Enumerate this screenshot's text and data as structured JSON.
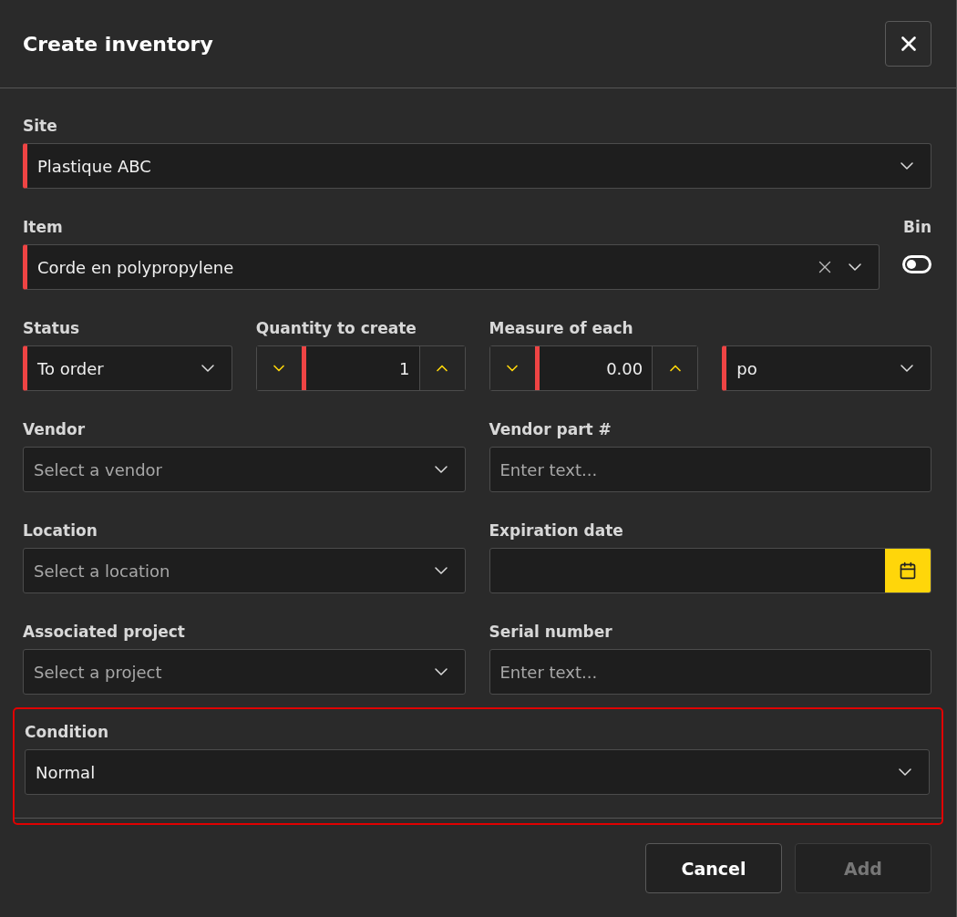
{
  "dialog": {
    "title": "Create inventory"
  },
  "rows": [
    {
      "kind": "full",
      "fields": [
        {
          "kind": "select",
          "label": "Site",
          "value": "Plastique ABC",
          "required": true
        }
      ]
    },
    {
      "kind": "item",
      "fields": [
        {
          "kind": "select",
          "label": "Item",
          "value": "Corde en polypropylene",
          "required": true,
          "clearable": true
        },
        {
          "kind": "toggle",
          "label": "Bin",
          "on": false
        }
      ]
    },
    {
      "kind": "quad",
      "fields": [
        {
          "kind": "select",
          "label": "Status",
          "value": "To order",
          "required": true
        },
        {
          "kind": "stepper",
          "label": "Quantity to create",
          "value": "1",
          "required": true
        },
        {
          "kind": "stepper",
          "label": "Measure of each",
          "value": "0.00",
          "required": true
        },
        {
          "kind": "select",
          "value": "po",
          "required": true
        }
      ]
    },
    {
      "kind": "pair",
      "fields": [
        {
          "kind": "select",
          "label": "Vendor",
          "placeholder": "Select a vendor",
          "required": false
        },
        {
          "kind": "text",
          "label": "Vendor part #",
          "placeholder": "Enter text...",
          "required": false
        }
      ]
    },
    {
      "kind": "pair",
      "fields": [
        {
          "kind": "select",
          "label": "Location",
          "placeholder": "Select a location",
          "required": false
        },
        {
          "kind": "date",
          "label": "Expiration date",
          "required": false
        }
      ]
    },
    {
      "kind": "pair",
      "fields": [
        {
          "kind": "select",
          "label": "Associated project",
          "placeholder": "Select a project",
          "required": false
        },
        {
          "kind": "text",
          "label": "Serial number",
          "placeholder": "Enter text...",
          "required": false
        }
      ]
    }
  ],
  "condition": {
    "highlighted": true,
    "field": {
      "kind": "select",
      "label": "Condition",
      "value": "Normal",
      "required": false
    }
  },
  "buttons": [
    {
      "label": "Cancel",
      "disabled": false
    },
    {
      "label": "Add",
      "disabled": true
    }
  ]
}
